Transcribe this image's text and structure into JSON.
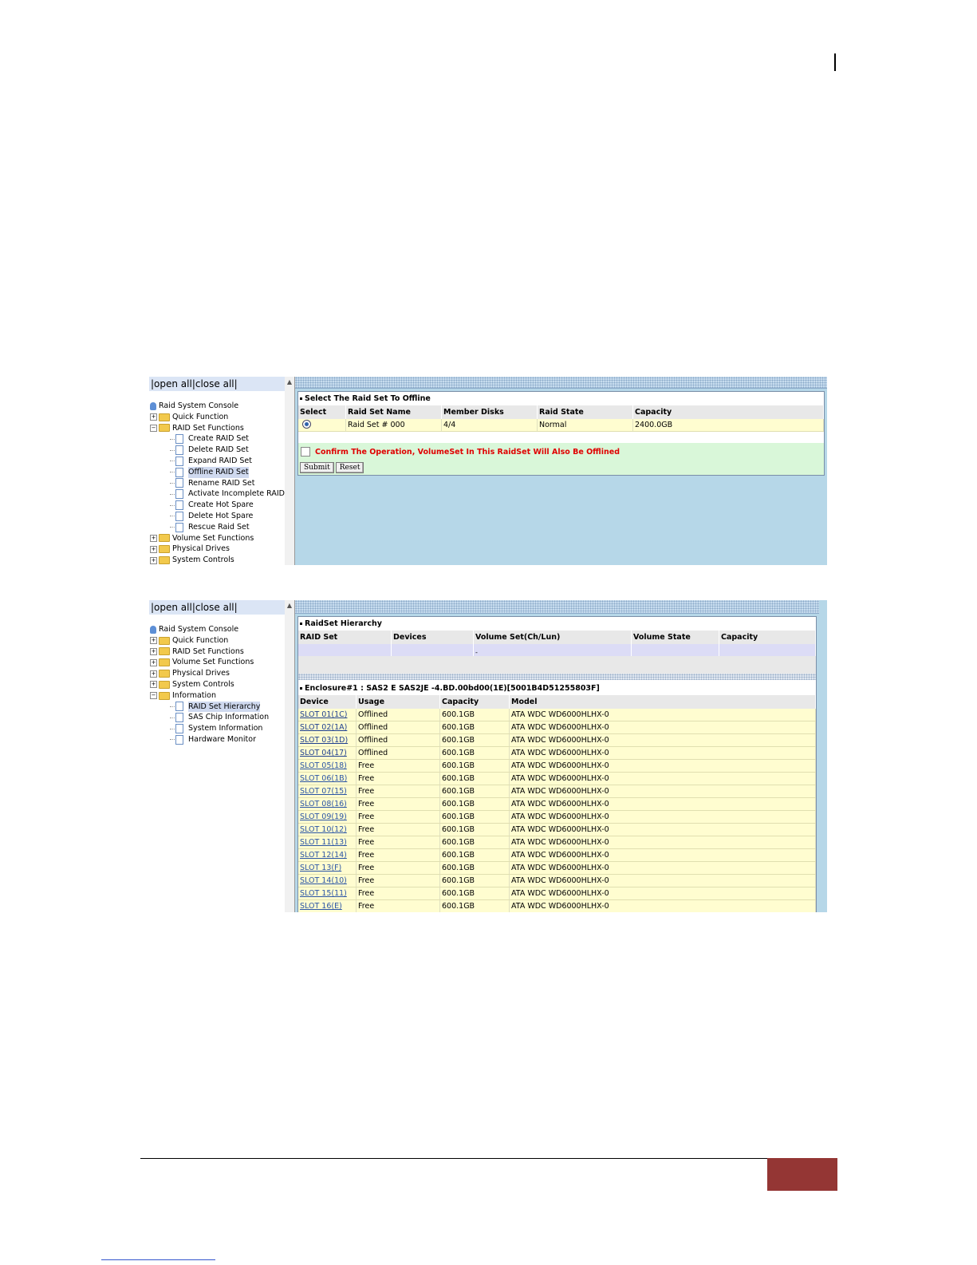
{
  "tree": {
    "open_close": "|open all|close all|",
    "screen1_items": [
      {
        "label": "Raid System Console",
        "kind": "root"
      },
      {
        "label": "Quick Function",
        "kind": "folder",
        "exp": "+"
      },
      {
        "label": "RAID Set Functions",
        "kind": "folder",
        "exp": "−"
      },
      {
        "label": "Create RAID Set",
        "kind": "leaf"
      },
      {
        "label": "Delete RAID Set",
        "kind": "leaf"
      },
      {
        "label": "Expand RAID Set",
        "kind": "leaf"
      },
      {
        "label": "Offline RAID Set",
        "kind": "leaf",
        "selected": true
      },
      {
        "label": "Rename RAID Set",
        "kind": "leaf"
      },
      {
        "label": "Activate Incomplete RAID",
        "kind": "leaf"
      },
      {
        "label": "Create Hot Spare",
        "kind": "leaf"
      },
      {
        "label": "Delete Hot Spare",
        "kind": "leaf"
      },
      {
        "label": "Rescue Raid Set",
        "kind": "leaf"
      },
      {
        "label": "Volume Set Functions",
        "kind": "folder",
        "exp": "+"
      },
      {
        "label": "Physical Drives",
        "kind": "folder",
        "exp": "+"
      },
      {
        "label": "System Controls",
        "kind": "folder",
        "exp": "+"
      }
    ],
    "screen2_items": [
      {
        "label": "Raid System Console",
        "kind": "root"
      },
      {
        "label": "Quick Function",
        "kind": "folder",
        "exp": "+"
      },
      {
        "label": "RAID Set Functions",
        "kind": "folder",
        "exp": "+"
      },
      {
        "label": "Volume Set Functions",
        "kind": "folder",
        "exp": "+"
      },
      {
        "label": "Physical Drives",
        "kind": "folder",
        "exp": "+"
      },
      {
        "label": "System Controls",
        "kind": "folder",
        "exp": "+"
      },
      {
        "label": "Information",
        "kind": "folder",
        "exp": "−"
      },
      {
        "label": "RAID Set Hierarchy",
        "kind": "leaf",
        "selected": true
      },
      {
        "label": "SAS Chip Information",
        "kind": "leaf"
      },
      {
        "label": "System Information",
        "kind": "leaf"
      },
      {
        "label": "Hardware Monitor",
        "kind": "leaf"
      }
    ]
  },
  "offline": {
    "title": "Select The Raid Set To Offline",
    "headers": [
      "Select",
      "Raid Set Name",
      "Member Disks",
      "Raid State",
      "Capacity"
    ],
    "row": {
      "name": "Raid Set # 000",
      "disks": "4/4",
      "state": "Normal",
      "capacity": "2400.0GB"
    },
    "confirm": "Confirm The Operation, VolumeSet In This RaidSet Will Also Be Offlined",
    "submit": "Submit",
    "reset": "Reset"
  },
  "hierarchy": {
    "title": "RaidSet Hierarchy",
    "headers": [
      "RAID Set",
      "Devices",
      "Volume Set(Ch/Lun)",
      "Volume State",
      "Capacity"
    ],
    "empty_mark": "-"
  },
  "enclosure": {
    "title": "Enclosure#1 : SAS2 E SAS2JE -4.BD.00bd00(1E)[5001B4D51255803F]",
    "headers": [
      "Device",
      "Usage",
      "Capacity",
      "Model"
    ],
    "rows": [
      {
        "device": "SLOT 01(1C)",
        "usage": "Offlined",
        "capacity": "600.1GB",
        "model": "ATA WDC WD6000HLHX-0"
      },
      {
        "device": "SLOT 02(1A)",
        "usage": "Offlined",
        "capacity": "600.1GB",
        "model": "ATA WDC WD6000HLHX-0"
      },
      {
        "device": "SLOT 03(1D)",
        "usage": "Offlined",
        "capacity": "600.1GB",
        "model": "ATA WDC WD6000HLHX-0"
      },
      {
        "device": "SLOT 04(17)",
        "usage": "Offlined",
        "capacity": "600.1GB",
        "model": "ATA WDC WD6000HLHX-0"
      },
      {
        "device": "SLOT 05(18)",
        "usage": "Free",
        "capacity": "600.1GB",
        "model": "ATA WDC WD6000HLHX-0"
      },
      {
        "device": "SLOT 06(1B)",
        "usage": "Free",
        "capacity": "600.1GB",
        "model": "ATA WDC WD6000HLHX-0"
      },
      {
        "device": "SLOT 07(15)",
        "usage": "Free",
        "capacity": "600.1GB",
        "model": "ATA WDC WD6000HLHX-0"
      },
      {
        "device": "SLOT 08(16)",
        "usage": "Free",
        "capacity": "600.1GB",
        "model": "ATA WDC WD6000HLHX-0"
      },
      {
        "device": "SLOT 09(19)",
        "usage": "Free",
        "capacity": "600.1GB",
        "model": "ATA WDC WD6000HLHX-0"
      },
      {
        "device": "SLOT 10(12)",
        "usage": "Free",
        "capacity": "600.1GB",
        "model": "ATA WDC WD6000HLHX-0"
      },
      {
        "device": "SLOT 11(13)",
        "usage": "Free",
        "capacity": "600.1GB",
        "model": "ATA WDC WD6000HLHX-0"
      },
      {
        "device": "SLOT 12(14)",
        "usage": "Free",
        "capacity": "600.1GB",
        "model": "ATA WDC WD6000HLHX-0"
      },
      {
        "device": "SLOT 13(F)",
        "usage": "Free",
        "capacity": "600.1GB",
        "model": "ATA WDC WD6000HLHX-0"
      },
      {
        "device": "SLOT 14(10)",
        "usage": "Free",
        "capacity": "600.1GB",
        "model": "ATA WDC WD6000HLHX-0"
      },
      {
        "device": "SLOT 15(11)",
        "usage": "Free",
        "capacity": "600.1GB",
        "model": "ATA WDC WD6000HLHX-0"
      },
      {
        "device": "SLOT 16(E)",
        "usage": "Free",
        "capacity": "600.1GB",
        "model": "ATA WDC WD6000HLHX-0"
      }
    ]
  },
  "colors": {
    "page_tab": "#943634",
    "frame_bg": "#b6d7e8",
    "confirm_text": "#e00000"
  }
}
